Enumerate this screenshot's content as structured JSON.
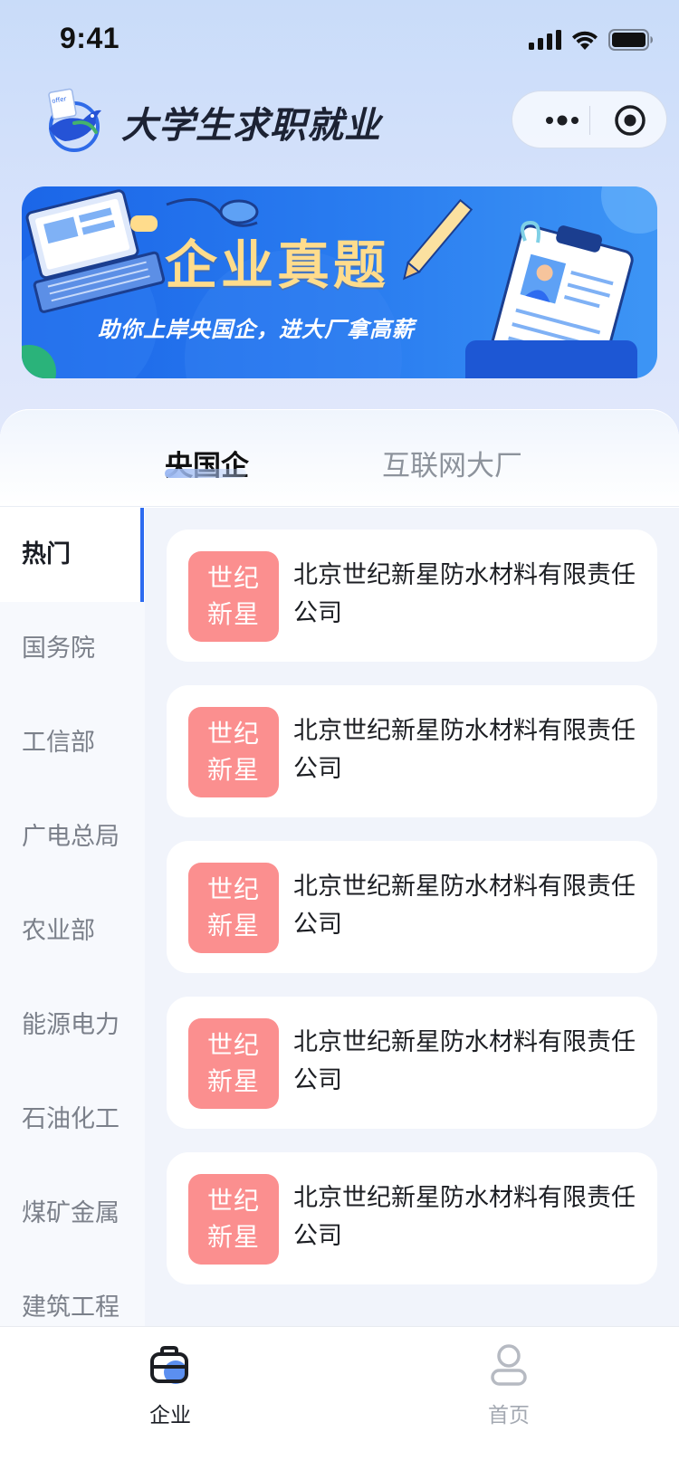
{
  "status_bar": {
    "time": "9:41"
  },
  "header": {
    "app_title": "大学生求职就业",
    "logo_icon": "dove-letter-logo-icon",
    "more_icon": "more-dots-icon",
    "close_icon": "target-close-icon"
  },
  "banner": {
    "title": "企业真题",
    "subtitle": "助你上岸央国企，进大厂拿高薪"
  },
  "tabs": [
    {
      "label": "央国企",
      "active": true
    },
    {
      "label": "互联网大厂",
      "active": false
    }
  ],
  "sidebar": {
    "items": [
      {
        "label": "热门",
        "active": true
      },
      {
        "label": "国务院"
      },
      {
        "label": "工信部"
      },
      {
        "label": "广电总局"
      },
      {
        "label": "农业部"
      },
      {
        "label": "能源电力"
      },
      {
        "label": "石油化工"
      },
      {
        "label": "煤矿金属"
      },
      {
        "label": "建筑工程"
      }
    ]
  },
  "companies": [
    {
      "logo_line1": "世纪",
      "logo_line2": "新星",
      "name": "北京世纪新星防水材料有限责任公司"
    },
    {
      "logo_line1": "世纪",
      "logo_line2": "新星",
      "name": "北京世纪新星防水材料有限责任公司"
    },
    {
      "logo_line1": "世纪",
      "logo_line2": "新星",
      "name": "北京世纪新星防水材料有限责任公司"
    },
    {
      "logo_line1": "世纪",
      "logo_line2": "新星",
      "name": "北京世纪新星防水材料有限责任公司"
    },
    {
      "logo_line1": "世纪",
      "logo_line2": "新星",
      "name": "北京世纪新星防水材料有限责任公司"
    }
  ],
  "tabbar": {
    "items": [
      {
        "label": "企业",
        "icon": "briefcase-icon",
        "active": true
      },
      {
        "label": "首页",
        "icon": "user-icon",
        "active": false
      }
    ]
  },
  "colors": {
    "accent": "#2d6bf0",
    "company_logo_bg": "#fb8f8f",
    "banner_title": "#ffdc8c"
  }
}
